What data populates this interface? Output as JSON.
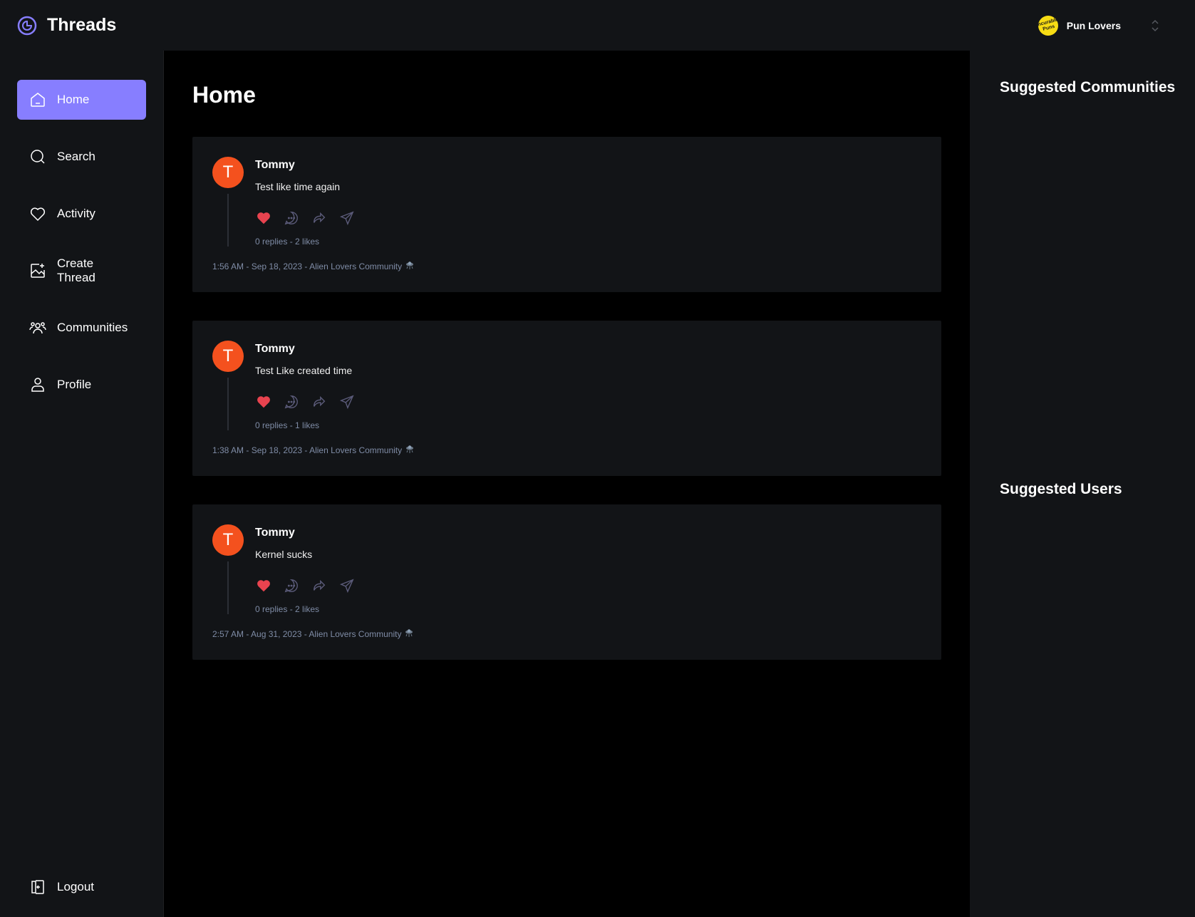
{
  "topbar": {
    "brand_name": "Threads",
    "brand_logo_icon": "threads-logo-icon",
    "org_name": "Pun Lovers",
    "org_avatar_text": "Incurable Puns",
    "org_switcher_icon": "chevron-up-down-icon"
  },
  "sidebar": {
    "items": [
      {
        "label": "Home",
        "icon": "home-icon",
        "active": true
      },
      {
        "label": "Search",
        "icon": "search-icon",
        "active": false
      },
      {
        "label": "Activity",
        "icon": "heart-icon",
        "active": false
      },
      {
        "label": "Create Thread",
        "icon": "create-image-icon",
        "active": false
      },
      {
        "label": "Communities",
        "icon": "users-icon",
        "active": false
      },
      {
        "label": "Profile",
        "icon": "user-icon",
        "active": false
      }
    ],
    "logout_label": "Logout"
  },
  "main": {
    "title": "Home",
    "threads": [
      {
        "author": "Tommy",
        "avatar_letter": "T",
        "content": "Test like time again",
        "stats": "0 replies - 2 likes",
        "footer": "1:56 AM - Sep 18, 2023 - Alien Lovers Community",
        "community_icon": "alien-ufo-icon"
      },
      {
        "author": "Tommy",
        "avatar_letter": "T",
        "content": "Test Like created time",
        "stats": "0 replies - 1 likes",
        "footer": "1:38 AM - Sep 18, 2023 - Alien Lovers Community",
        "community_icon": "alien-ufo-icon"
      },
      {
        "author": "Tommy",
        "avatar_letter": "T",
        "content": "Kernel sucks",
        "stats": "0 replies - 2 likes",
        "footer": "2:57 AM - Aug 31, 2023 - Alien Lovers Community",
        "community_icon": "alien-ufo-icon"
      }
    ]
  },
  "rightbar": {
    "communities_heading": "Suggested Communities",
    "users_heading": "Suggested Users"
  },
  "colors": {
    "accent": "#877eff",
    "avatar": "#f4511e",
    "like": "#e8434f",
    "panel": "#121417",
    "muted": "#7f8ca6"
  }
}
